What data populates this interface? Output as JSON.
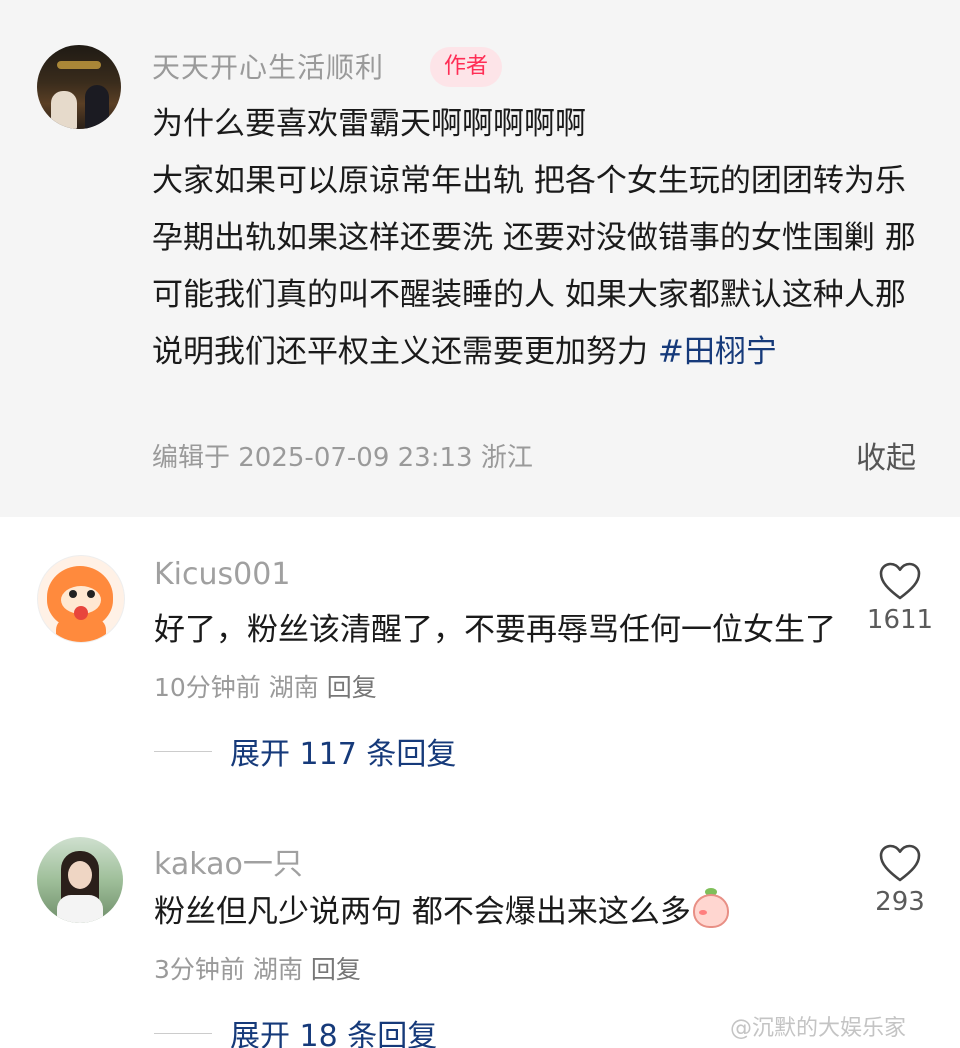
{
  "author_post": {
    "name": "天天开心生活顺利",
    "badge": "作者",
    "text_lines": [
      "为什么要喜欢雷霸天啊啊啊啊啊",
      "大家如果可以原谅常年出轨 把各个女生玩的团团转为乐 孕期出轨如果这样还要洗 还要对没做错事的女性围剿 那可能我们真的叫不醒装睡的人 如果大家都默认这种人那说明我们还平权主义还需要更加努力 "
    ],
    "hashtag": "#田栩宁",
    "meta": "编辑于  2025-07-09 23:13 浙江",
    "collapse_label": "收起"
  },
  "comments": [
    {
      "name": "Kicus001",
      "text": "好了，粉丝该清醒了，不要再辱骂任何一位女生了",
      "time": "10分钟前",
      "location": "湖南",
      "reply_label": "回复",
      "likes": "1611",
      "expand_label": "展开 117 条回复"
    },
    {
      "name": "kakao一只",
      "text": "粉丝但凡少说两句 都不会爆出来这么多",
      "time": "3分钟前",
      "location": "湖南",
      "reply_label": "回复",
      "likes": "293",
      "expand_label": "展开 18 条回复"
    }
  ],
  "watermark": "@沉默的大娱乐家",
  "icons": {
    "like": "heart-outline-icon",
    "emoji": "peach-emoji-icon"
  },
  "colors": {
    "author_bg": "#f5f5f5",
    "badge_text": "#ff2d55",
    "badge_bg": "#fde4e8",
    "link": "#163a7a"
  }
}
